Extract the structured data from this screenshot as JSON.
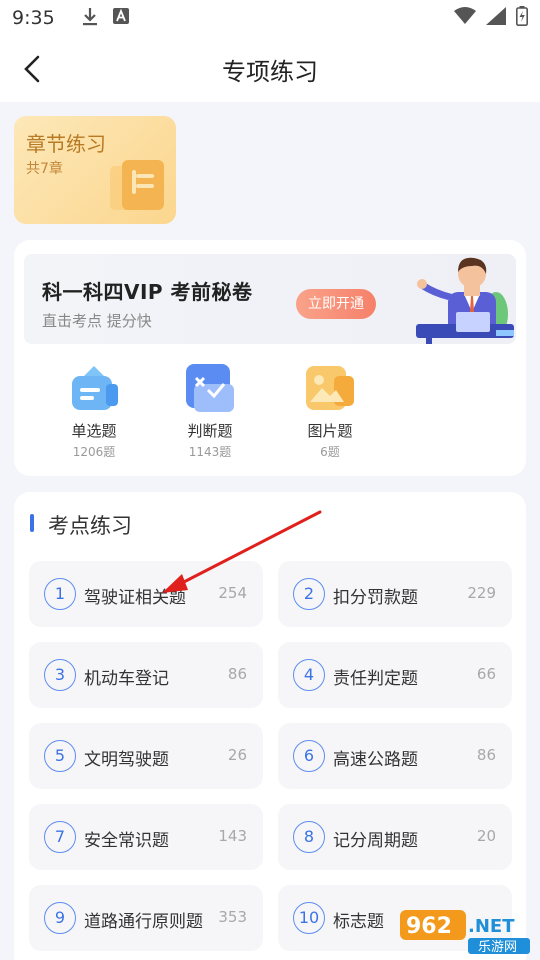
{
  "status": {
    "time": "9:35"
  },
  "header": {
    "title": "专项练习"
  },
  "chapter": {
    "title": "章节练习",
    "subtitle": "共7章"
  },
  "vip": {
    "title": "科一科四VIP  考前秘卷",
    "subtitle": "直击考点 提分快",
    "button": "立即开通"
  },
  "qtypes": [
    {
      "name": "单选题",
      "count": "1206题"
    },
    {
      "name": "判断题",
      "count": "1143题"
    },
    {
      "name": "图片题",
      "count": "6题"
    }
  ],
  "topics": {
    "title": "考点练习",
    "items": [
      {
        "num": "1",
        "name": "驾驶证相关题",
        "count": "254"
      },
      {
        "num": "2",
        "name": "扣分罚款题",
        "count": "229"
      },
      {
        "num": "3",
        "name": "机动车登记",
        "count": "86"
      },
      {
        "num": "4",
        "name": "责任判定题",
        "count": "66"
      },
      {
        "num": "5",
        "name": "文明驾驶题",
        "count": "26"
      },
      {
        "num": "6",
        "name": "高速公路题",
        "count": "86"
      },
      {
        "num": "7",
        "name": "安全常识题",
        "count": "143"
      },
      {
        "num": "8",
        "name": "记分周期题",
        "count": "20"
      },
      {
        "num": "9",
        "name": "道路通行原则题",
        "count": "353"
      },
      {
        "num": "10",
        "name": "标志题",
        "count": ""
      }
    ]
  },
  "watermark": {
    "top": "962.NET",
    "bottom": "乐游网"
  }
}
